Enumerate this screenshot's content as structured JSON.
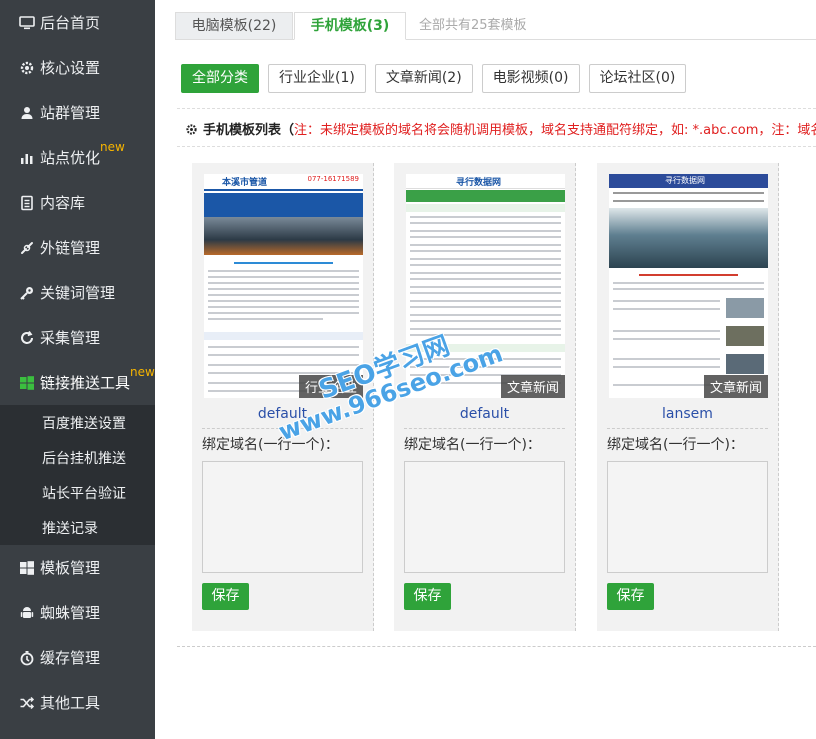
{
  "sidebar": {
    "items": [
      {
        "label": "后台首页",
        "icon": "monitor-icon"
      },
      {
        "label": "核心设置",
        "icon": "gear-icon"
      },
      {
        "label": "站群管理",
        "icon": "user-icon"
      },
      {
        "label": "站点优化",
        "icon": "bar-chart-icon",
        "badge": "new"
      },
      {
        "label": "内容库",
        "icon": "document-icon"
      },
      {
        "label": "外链管理",
        "icon": "link-icon"
      },
      {
        "label": "关键词管理",
        "icon": "key-icon"
      },
      {
        "label": "采集管理",
        "icon": "refresh-icon"
      },
      {
        "label": "链接推送工具",
        "icon": "windows-icon",
        "badge": "new"
      }
    ],
    "sub_items": [
      "百度推送设置",
      "后台挂机推送",
      "站长平台验证",
      "推送记录"
    ],
    "items_after": [
      {
        "label": "模板管理",
        "icon": "windows-icon"
      },
      {
        "label": "蜘蛛管理",
        "icon": "android-icon"
      },
      {
        "label": "缓存管理",
        "icon": "clock-icon"
      },
      {
        "label": "其他工具",
        "icon": "shuffle-icon"
      }
    ]
  },
  "tabs": {
    "pc": "电脑模板(22)",
    "mobile": "手机模板(3)",
    "total": "全部共有25套模板"
  },
  "filters": [
    "全部分类",
    "行业企业(1)",
    "文章新闻(2)",
    "电影视频(0)",
    "论坛社区(0)"
  ],
  "list": {
    "title": "手机模板列表（",
    "note": "注：未绑定模板的域名将会随机调用模板，域名支持通配符绑定，如: *.abc.com，注：域名"
  },
  "cards": [
    {
      "name": "default",
      "tag": "行业企业",
      "bind_label": "绑定域名(一行一个)：",
      "save": "保存"
    },
    {
      "name": "default",
      "tag": "文章新闻",
      "bind_label": "绑定域名(一行一个)：",
      "save": "保存"
    },
    {
      "name": "lansem",
      "tag": "文章新闻",
      "bind_label": "绑定域名(一行一个)：",
      "save": "保存"
    }
  ],
  "thumbs": {
    "t1_header": "本溪市管道",
    "t1_phone": "077-16171589",
    "t2_header": "寻行数据网",
    "t3_header": "寻行数据网"
  },
  "watermark": {
    "line1": "SEO学习网",
    "line2": "www.966seo.com"
  },
  "colors": {
    "accent": "#2fa33a",
    "sidebar": "#3a3f44",
    "badge": "#f7b500",
    "note": "#e02020"
  }
}
